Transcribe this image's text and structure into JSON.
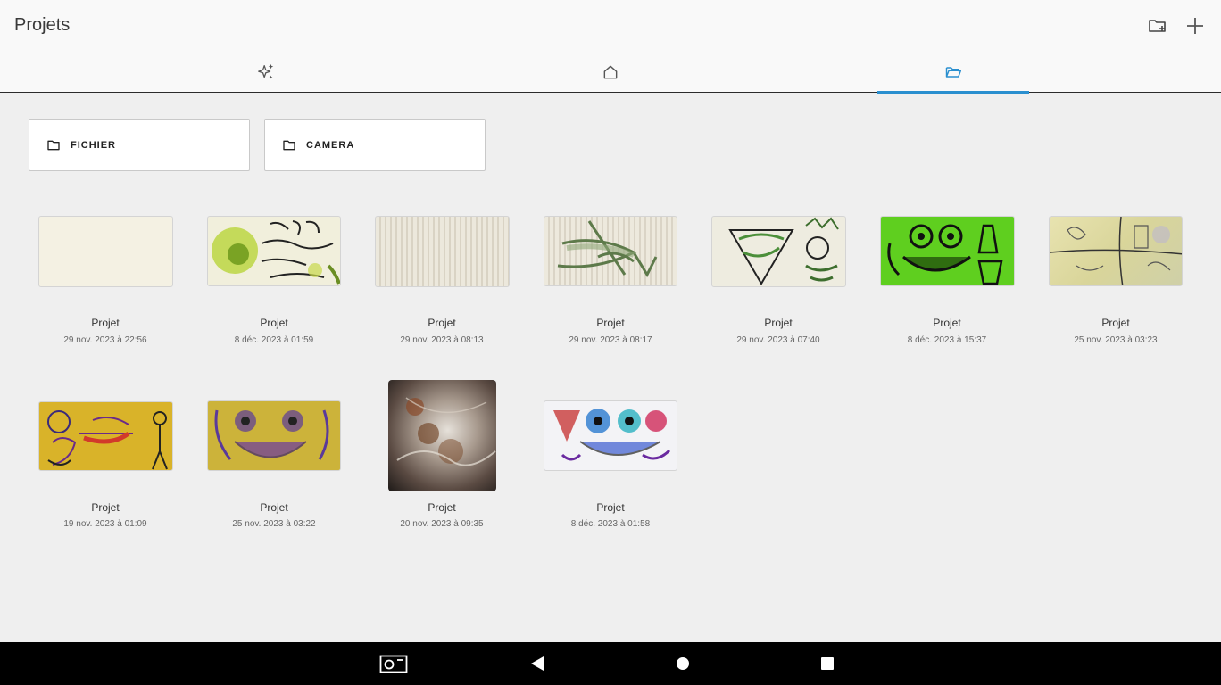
{
  "app": {
    "title": "Projets"
  },
  "toolbar": {
    "new_folder_icon": "folder-add-icon",
    "add_icon": "plus-icon"
  },
  "tabs": [
    {
      "icon": "sparkle-icon",
      "active": false
    },
    {
      "icon": "home-icon",
      "active": false
    },
    {
      "icon": "folder-open-icon",
      "active": true
    }
  ],
  "sources": [
    {
      "label": "FICHIER",
      "icon": "folder-icon"
    },
    {
      "label": "CAMERA",
      "icon": "folder-icon"
    }
  ],
  "projects": [
    {
      "title": "Projet",
      "date": "29 nov. 2023 à 22:56"
    },
    {
      "title": "Projet",
      "date": "8 déc. 2023 à 01:59"
    },
    {
      "title": "Projet",
      "date": "29 nov. 2023 à 08:13"
    },
    {
      "title": "Projet",
      "date": "29 nov. 2023 à 08:17"
    },
    {
      "title": "Projet",
      "date": "29 nov. 2023 à 07:40"
    },
    {
      "title": "Projet",
      "date": "8 déc. 2023 à 15:37"
    },
    {
      "title": "Projet",
      "date": "25 nov. 2023 à 03:23"
    },
    {
      "title": "Projet",
      "date": "19 nov. 2023 à 01:09"
    },
    {
      "title": "Projet",
      "date": "25 nov. 2023 à 03:22"
    },
    {
      "title": "Projet",
      "date": "20 nov. 2023 à 09:35"
    },
    {
      "title": "Projet",
      "date": "8 déc. 2023 à 01:58"
    }
  ],
  "colors": {
    "accent": "#2a8fcf",
    "navbar": "#000000",
    "background": "#efefef"
  },
  "navbar": {
    "icons": [
      "screenshot-icon",
      "back-icon",
      "home-icon",
      "recents-icon"
    ]
  }
}
